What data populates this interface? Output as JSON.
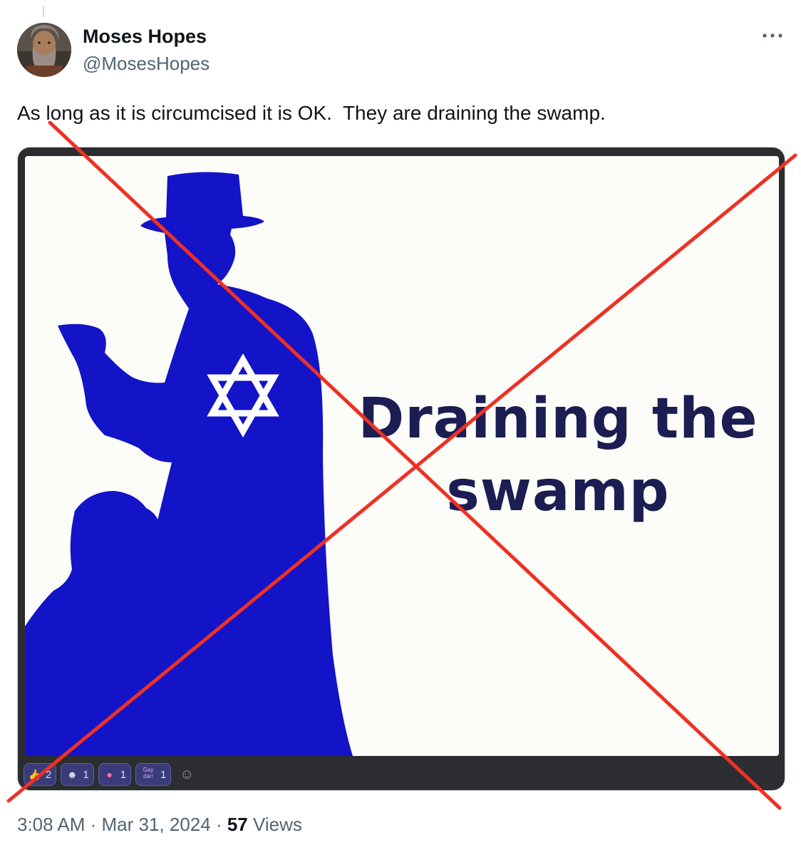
{
  "tweet": {
    "author": {
      "name": "Moses Hopes",
      "handle": "@MosesHopes",
      "avatar_icon": "avatar-portrait"
    },
    "more_icon": "more-dots-icon",
    "text": "As long as it is circumcised it is OK.  They are draining the swamp.",
    "media": {
      "caption_line1": "Draining the",
      "caption_line2": "swamp",
      "silhouette_color": "#1313c8",
      "caption_color": "#1c1d52",
      "reactions": [
        {
          "icon": "thumbs-up-icon",
          "count": "2"
        },
        {
          "icon": "face-icon",
          "count": "1"
        },
        {
          "icon": "pig-icon",
          "count": "1"
        },
        {
          "icon": "gay-dar-sticker-icon",
          "label": "Gay dar!",
          "count": "1"
        },
        {
          "icon": "add-reaction-icon"
        }
      ]
    },
    "overlay": {
      "icon": "red-x-cross",
      "color": "#ee3124"
    },
    "meta": {
      "time": "3:08 AM",
      "separator": " · ",
      "date": "Mar 31, 2024",
      "views_count": "57",
      "views_label": "Views"
    }
  }
}
